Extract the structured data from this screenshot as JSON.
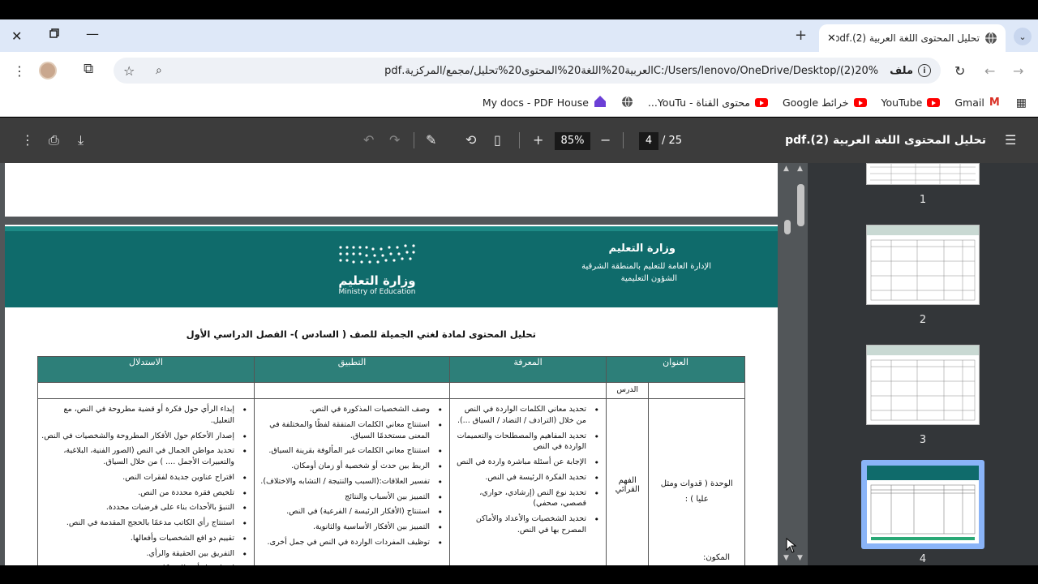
{
  "browser": {
    "tab_title": "تحليل المحتوى اللغة العربية (2).pdf",
    "address": "C:/Users/lenovo/OneDrive/Desktop/(2)20%العربية20%اللغة20%المحتوى20%تحليل/مجمع/المركزية.pdf",
    "file_chip": "ملف",
    "bookmarks": [
      {
        "label": "Gmail",
        "icon": "gmail-icon"
      },
      {
        "label": "YouTube",
        "icon": "youtube-icon"
      },
      {
        "label": "خرائط Google",
        "icon": "youtube-icon"
      },
      {
        "label": "محتوى القناة - YouTu...",
        "icon": "youtube-icon"
      },
      {
        "label": "My docs - PDF House",
        "icon": "pdf-house-icon"
      }
    ]
  },
  "pdf_toolbar": {
    "title": "تحليل المحتوى اللغة العربية (2).pdf",
    "current_page": "4",
    "total_pages": "/  25",
    "zoom": "85%"
  },
  "thumbnails": [
    "1",
    "2",
    "3",
    "4"
  ],
  "document": {
    "ministry": "وزارة التعليم",
    "admin_line1": "الإدارة العامة للتعليم بالمنطقة الشرقية",
    "admin_line2": "الشؤون التعليمية",
    "logo_ar": "وزارة التعليم",
    "logo_en": "Ministry of Education",
    "heading": "تحليل المحتوى لمادة لغتي الجميلة للصف (  السادس  )- الفصل الدراسي الأول",
    "col_title": "العنوان",
    "col_knowledge": "المعرفة",
    "col_application": "التطبيق",
    "col_reasoning": "الاستدلال",
    "sub_lesson": "الدرس",
    "unit_label": "الوحدة ( قدوات ومثل عليا ) :",
    "component_label": "المكون:",
    "lesson_name": "الفهم القرائي",
    "knowledge": [
      "تحديد معاني الكلمات الواردة في النص من خلال (الترادف / التضاد / السياق ...).",
      "تحديد المفاهيم والمصطلحات والتعميمات الواردة في النص",
      "الإجابة عن أسئلة مباشرة واردة في النص",
      "تحديد الفكرة الرئيسة في النص.",
      "تحديد نوع النص (إرشادي، حواري، قصصي، صحفي)",
      "تحديد الشخصيات والأعداد والأماكن المصرح بها في النص."
    ],
    "application": [
      "وصف الشخصيات المذكورة في النص.",
      "استنتاج معاني الكلمات المتفقة لفظًا والمختلفة في المعنى مستخدمًا السياق.",
      "استنتاج معاني الكلمات غير المألوفة بقرينة السياق.",
      "الربط بين حدث أو شخصية أو زمان أومكان.",
      "تفسير العلاقات:(السبب والنتيجة / التشابه والاختلاف).",
      "التمييز بين الأسباب والنتائج",
      "استنتاج (الأفكار الرئيسة / الفرعية) في النص.",
      "التمييز بين الأفكار الأساسية والثانوية.",
      "توظيف المفردات الواردة في النص في جمل أخرى."
    ],
    "reasoning": [
      "إبداء الرأي حول فكرة أو قضية مطروحة في النص، مع التعليل.",
      "إصدار الأحكام حول الأفكار المطروحة والشخصيات في النص.",
      "تحديد مواطن الجمال في النص (الصور الفنية، البلاغية، والتعبيرات الأجمل .... ) من خلال السياق.",
      "اقتراح عناوين جديدة لفقرات النص.",
      "تلخيص فقرة محددة من النص.",
      "التنبؤ بالأحداث بناء على فرضيات محددة.",
      "استنتاج رأي الكاتب مدعمًا بالحجج المقدمة في النص.",
      "تقييم دو افع الشخصيات وأفعالها.",
      "التفريق بين الحقيقة والرأي.",
      "اقتراح حل أخر للمشكلة."
    ]
  }
}
